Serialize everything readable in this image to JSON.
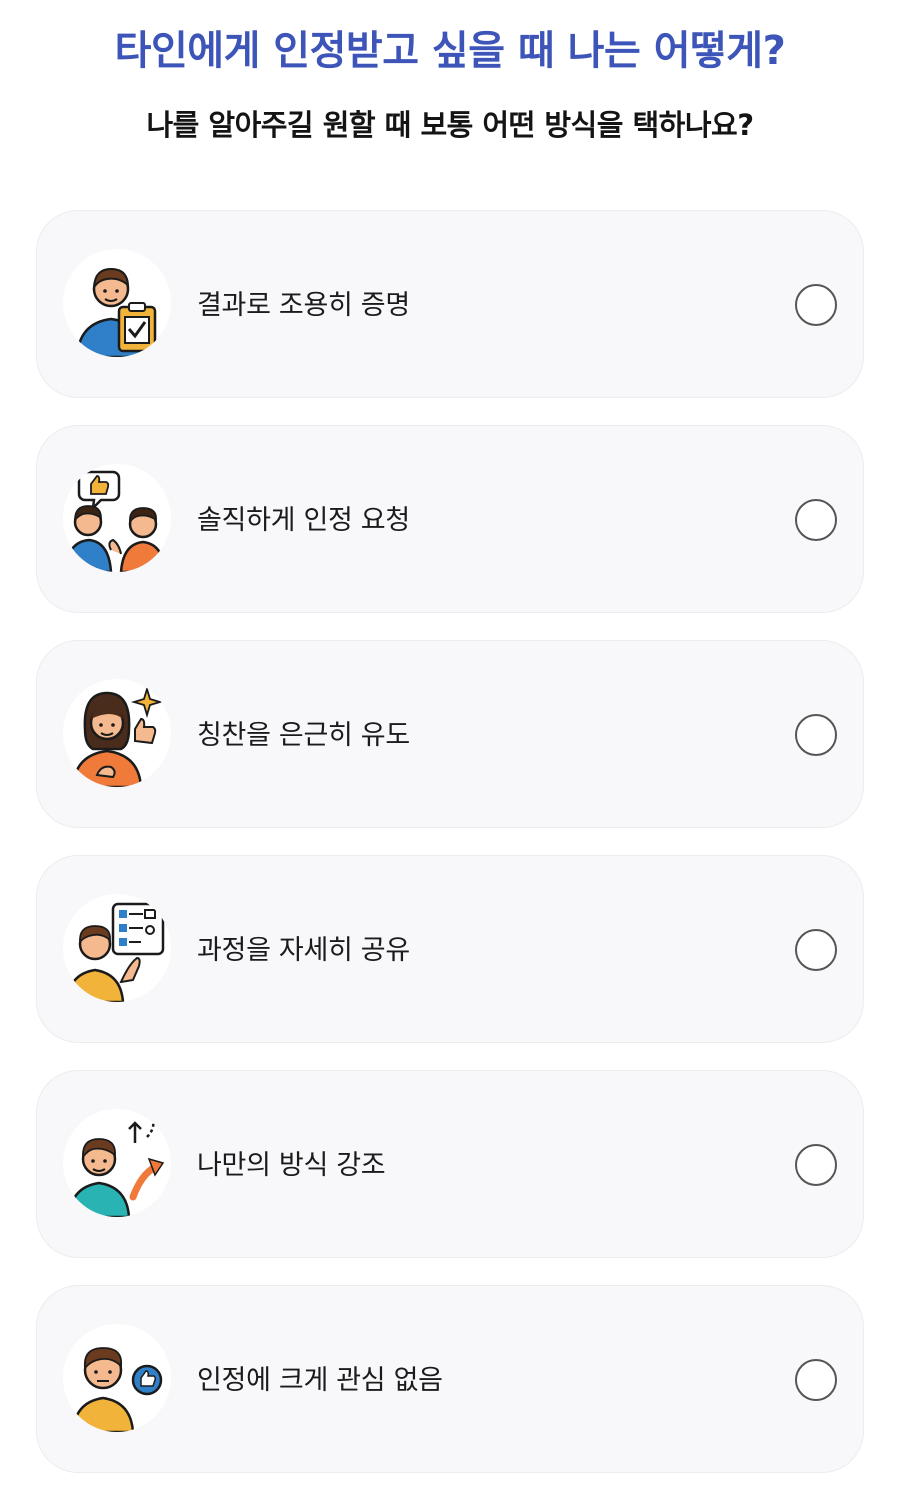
{
  "header": {
    "title": "타인에게 인정받고 싶을 때 나는 어떻게?",
    "subtitle": "나를 알아주길 원할 때 보통 어떤 방식을 택하나요?"
  },
  "options": [
    {
      "label": "결과로 조용히 증명",
      "icon": "person-clipboard-check-icon",
      "selected": false
    },
    {
      "label": "솔직하게 인정 요청",
      "icon": "two-people-thumbs-up-bubble-icon",
      "selected": false
    },
    {
      "label": "칭찬을 은근히 유도",
      "icon": "woman-thumbs-up-sparkle-icon",
      "selected": false
    },
    {
      "label": "과정을 자세히 공유",
      "icon": "person-flowchart-icon",
      "selected": false
    },
    {
      "label": "나만의 방식 강조",
      "icon": "person-curved-arrow-icon",
      "selected": false
    },
    {
      "label": "인정에 크게 관심 없음",
      "icon": "person-neutral-badge-icon",
      "selected": false
    }
  ],
  "colors": {
    "title": "#3d55b8",
    "card_background": "#f8f8fa",
    "card_border": "#ececf0",
    "radio_border": "#555555"
  }
}
